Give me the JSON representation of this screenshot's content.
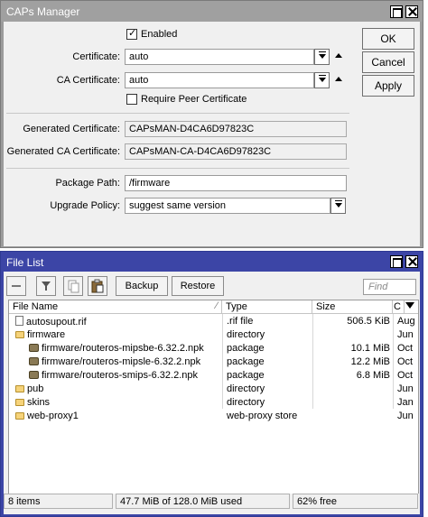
{
  "caps_window": {
    "title": "CAPs Manager",
    "enabled_label": "Enabled",
    "enabled_checked": true,
    "certificate_label": "Certificate:",
    "certificate_value": "auto",
    "ca_certificate_label": "CA Certificate:",
    "ca_certificate_value": "auto",
    "require_peer_label": "Require Peer Certificate",
    "require_peer_checked": false,
    "generated_cert_label": "Generated Certificate:",
    "generated_cert_value": "CAPsMAN-D4CA6D97823C",
    "generated_ca_label": "Generated CA Certificate:",
    "generated_ca_value": "CAPsMAN-CA-D4CA6D97823C",
    "package_path_label": "Package Path:",
    "package_path_value": "/firmware",
    "upgrade_policy_label": "Upgrade Policy:",
    "upgrade_policy_value": "suggest same version",
    "buttons": {
      "ok": "OK",
      "cancel": "Cancel",
      "apply": "Apply"
    }
  },
  "file_list": {
    "title": "File List",
    "toolbar": {
      "backup": "Backup",
      "restore": "Restore",
      "find_placeholder": "Find"
    },
    "columns": [
      "File Name",
      "Type",
      "Size",
      "C"
    ],
    "rows": [
      {
        "name": "autosupout.rif",
        "type": ".rif file",
        "size": "506.5 KiB",
        "c": "Aug",
        "icon": "file-icon",
        "indent": 0
      },
      {
        "name": "firmware",
        "type": "directory",
        "size": "",
        "c": "Jun",
        "icon": "folder-icon",
        "indent": 0
      },
      {
        "name": "firmware/routeros-mipsbe-6.32.2.npk",
        "type": "package",
        "size": "10.1 MiB",
        "c": "Oct",
        "icon": "package-icon",
        "indent": 1
      },
      {
        "name": "firmware/routeros-mipsle-6.32.2.npk",
        "type": "package",
        "size": "12.2 MiB",
        "c": "Oct",
        "icon": "package-icon",
        "indent": 1
      },
      {
        "name": "firmware/routeros-smips-6.32.2.npk",
        "type": "package",
        "size": "6.8 MiB",
        "c": "Oct",
        "icon": "package-icon",
        "indent": 1
      },
      {
        "name": "pub",
        "type": "directory",
        "size": "",
        "c": "Jun",
        "icon": "folder-icon",
        "indent": 0
      },
      {
        "name": "skins",
        "type": "directory",
        "size": "",
        "c": "Jan",
        "icon": "folder-icon",
        "indent": 0
      },
      {
        "name": "web-proxy1",
        "type": "web-proxy store",
        "size": "",
        "c": "Jun",
        "icon": "folder-icon",
        "indent": 0
      }
    ],
    "status": {
      "items": "8 items",
      "used": "47.7 MiB of 128.0 MiB used",
      "free": "62% free"
    }
  }
}
